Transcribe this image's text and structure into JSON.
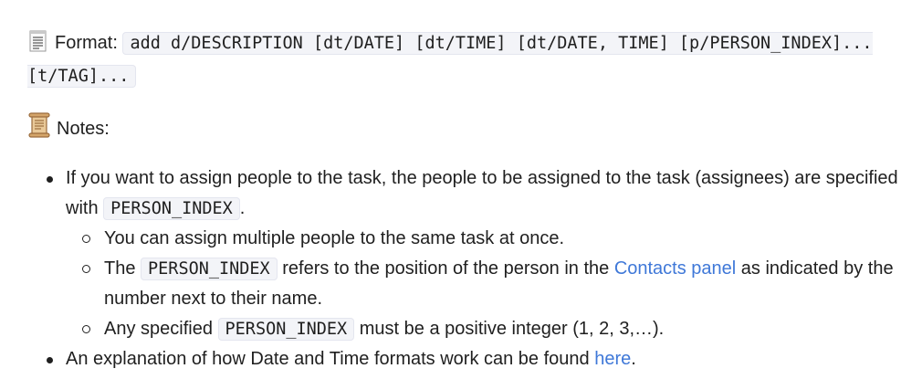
{
  "format": {
    "icon": "page-with-lines-icon",
    "label": "Format:",
    "code": "add d/DESCRIPTION [dt/DATE] [dt/TIME] [dt/DATE, TIME] [p/PERSON_INDEX]... [t/TAG]..."
  },
  "notes": {
    "icon": "scroll-icon",
    "label": "Notes:"
  },
  "bullets": {
    "b1": {
      "text_before": "If you want to assign people to the task, the people to be assigned to the task (assignees) are specified with",
      "code": "PERSON_INDEX",
      "text_after": "."
    },
    "sub1": {
      "text": "You can assign multiple people to the same task at once."
    },
    "sub2": {
      "text_before": "The",
      "code": "PERSON_INDEX",
      "text_middle": "refers to the position of the person in the",
      "link": "Contacts panel",
      "text_after": "as indicated by the number next to their name."
    },
    "sub3": {
      "text_before": "Any specified",
      "code": "PERSON_INDEX",
      "text_after": "must be a positive integer (1, 2, 3,…)."
    },
    "b2": {
      "text_before": "An explanation of how Date and Time formats work can be found",
      "link": "here",
      "text_after": "."
    }
  },
  "colors": {
    "link": "#3f78d8",
    "code_background": "#f3f4f8",
    "text": "#1f1f1f"
  }
}
